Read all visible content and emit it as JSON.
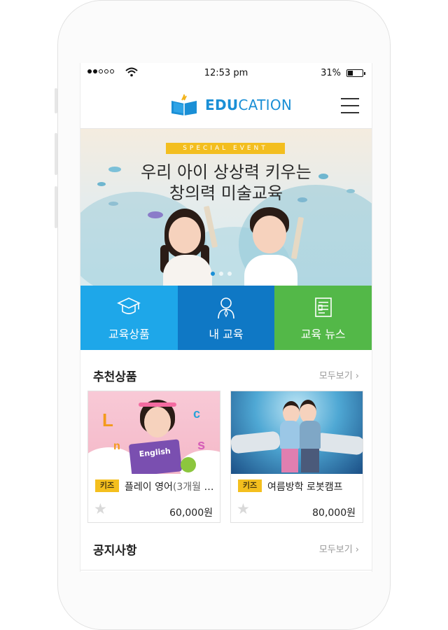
{
  "status_bar": {
    "time": "12:53 pm",
    "battery": "31%"
  },
  "header": {
    "logo_bold": "EDU",
    "logo_rest": "CATION"
  },
  "banner": {
    "event_tag": "SPECIAL EVENT",
    "headline_1": "우리 아이 상상력 키우는",
    "headline_2": "창의력 미술교육"
  },
  "quick_menu": [
    {
      "label": "교육상품",
      "icon": "graduation-cap-icon",
      "color": "#1ea7e9"
    },
    {
      "label": "내 교육",
      "icon": "person-icon",
      "color": "#0f78c5"
    },
    {
      "label": "교육 뉴스",
      "icon": "document-icon",
      "color": "#53b848"
    }
  ],
  "recommended": {
    "title": "추천상품",
    "more": "모두보기",
    "items": [
      {
        "tag": "키즈",
        "name": "플레이 영어",
        "sub": "(3개월 2...",
        "price": "60,000원",
        "image_text": "English"
      },
      {
        "tag": "키즈",
        "name": "여름방학 로봇캠프",
        "sub": "",
        "price": "80,000원"
      }
    ]
  },
  "notice": {
    "title": "공지사항",
    "more": "모두보기"
  }
}
